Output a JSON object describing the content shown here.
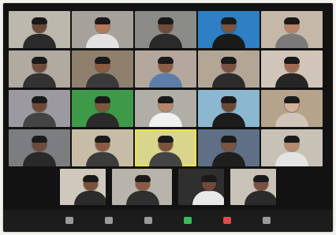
{
  "window": {
    "title": ""
  },
  "gallery": {
    "rows": [
      [
        {
          "name": "",
          "bg": "#bdb8ad",
          "skin": "#6b4a38",
          "shirt": "#2b2b2b"
        },
        {
          "name": "",
          "bg": "#a6a19a",
          "skin": "#b37a59",
          "shirt": "#e2e2e2"
        },
        {
          "name": "",
          "bg": "#8b8b88",
          "skin": "#6e4b3a",
          "shirt": "#2a2a2a"
        },
        {
          "name": "",
          "bg": "#2f7fc4",
          "skin": "#7b5540",
          "shirt": "#1a1a1a"
        },
        {
          "name": "",
          "bg": "#c6b8a8",
          "skin": "#b68366",
          "shirt": "#7a7a7a"
        }
      ],
      [
        {
          "name": "",
          "bg": "#b1aaa0",
          "skin": "#6e4d3b",
          "shirt": "#333333"
        },
        {
          "name": "",
          "bg": "#8f7f6d",
          "skin": "#8a5a41",
          "shirt": "#3a3a3a"
        },
        {
          "name": "",
          "bg": "#b4a89e",
          "skin": "#8b5d45",
          "shirt": "#5d7ea8"
        },
        {
          "name": "",
          "bg": "#b3a695",
          "skin": "#7a523f",
          "shirt": "#2c2c2c"
        },
        {
          "name": "",
          "bg": "#d0c5b8",
          "skin": "#9e6b52",
          "shirt": "#262626"
        }
      ],
      [
        {
          "name": "",
          "bg": "#9c9aa0",
          "skin": "#6e4a36",
          "shirt": "#444444"
        },
        {
          "name": "",
          "bg": "#3e9a48",
          "skin": "#7e563f",
          "shirt": "#2a2a2a"
        },
        {
          "name": "",
          "bg": "#b1aea8",
          "skin": "#b6866a",
          "shirt": "#f0f0f0"
        },
        {
          "name": "",
          "bg": "#8bb7d1",
          "skin": "#6d4a36",
          "shirt": "#1c1c1c"
        },
        {
          "name": "",
          "bg": "#b6a38b",
          "skin": "#d3b29a",
          "shirt": "#d1c4b8"
        }
      ],
      [
        {
          "name": "",
          "bg": "#7c7d80",
          "skin": "#6e4a38",
          "shirt": "#2a2a2a"
        },
        {
          "name": "",
          "bg": "#c7bda7",
          "skin": "#8a5b42",
          "shirt": "#3c3c3c"
        },
        {
          "name": "",
          "bg": "#d9d68b",
          "skin": "#7c523c",
          "shirt": "#444444",
          "active": true
        },
        {
          "name": "",
          "bg": "#5e6f86",
          "skin": "#7b533f",
          "shirt": "#1f1f1f"
        },
        {
          "name": "",
          "bg": "#c8c1b6",
          "skin": "#b58a6d",
          "shirt": "#e3e3e3"
        }
      ]
    ],
    "row5": [
      {
        "name": "",
        "bg": "#d0c8bd",
        "skin": "#7a523c",
        "shirt": "#2b2b2b"
      },
      {
        "name": "",
        "bg": "#b9b4ab",
        "skin": "#8a5b43",
        "shirt": "#2f2f2f",
        "wide": true
      },
      {
        "name": "",
        "bg": "#2f2f2f",
        "skin": "#6f4a38",
        "shirt": "#e8e8e8"
      },
      {
        "name": "",
        "bg": "#c8c2b8",
        "skin": "#7a513e",
        "shirt": "#2b2b2b"
      }
    ]
  },
  "toolbar": {
    "items": [
      {
        "name": "camera-button",
        "label": "",
        "icon": "camera-icon",
        "color": "#9a9a9a"
      },
      {
        "name": "participants-button",
        "label": "",
        "icon": "participants-icon",
        "color": "#9a9a9a"
      },
      {
        "name": "chat-button",
        "label": "",
        "icon": "chat-icon",
        "color": "#9a9a9a"
      },
      {
        "name": "share-screen-button",
        "label": "",
        "icon": "share-screen-icon",
        "color": "#3cbc5b"
      },
      {
        "name": "record-button",
        "label": "",
        "icon": "record-icon",
        "color": "#e04a4a"
      },
      {
        "name": "reactions-button",
        "label": "",
        "icon": "reactions-icon",
        "color": "#9a9a9a"
      }
    ]
  }
}
